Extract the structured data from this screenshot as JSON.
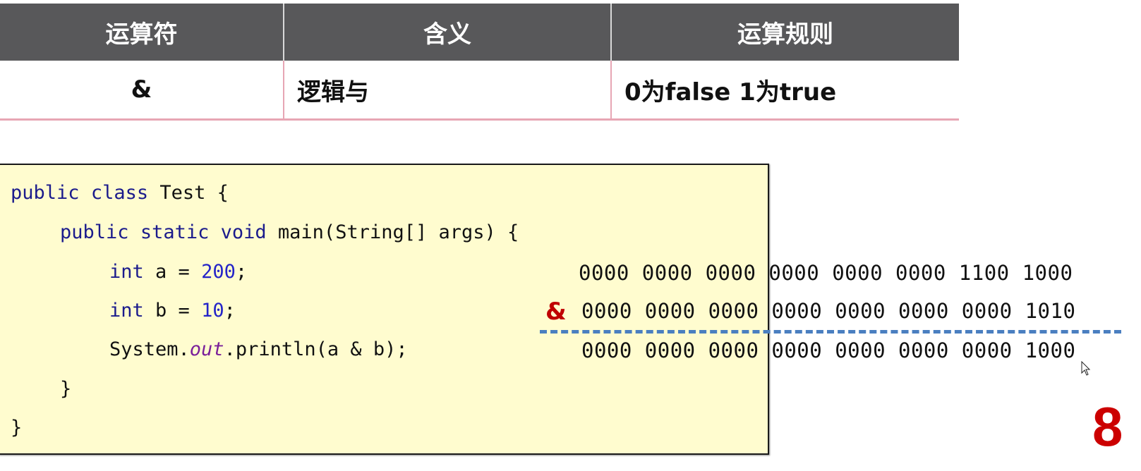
{
  "table": {
    "headers": [
      "运算符",
      "含义",
      "运算规则"
    ],
    "rows": [
      [
        "&",
        "逻辑与",
        "0为false 1为true"
      ]
    ]
  },
  "code": {
    "line1": {
      "kw1": "public",
      "kw2": "class",
      "rest": " Test {"
    },
    "line2": {
      "kw1": "public",
      "kw2": "static",
      "kw3": "void",
      "rest": " main(String[] args) {"
    },
    "line3": {
      "kw": "int",
      "mid": " a = ",
      "num": "200",
      "end": ";"
    },
    "line4": {
      "kw": "int",
      "mid": " b = ",
      "num": "10",
      "end": ";"
    },
    "line5": {
      "pre": "System.",
      "field": "out",
      "post": ".println(a & b);"
    },
    "line6": "}",
    "line7": "}"
  },
  "binary": {
    "a": "0000 0000 0000 0000 0000 0000 1100 1000",
    "operator": "&",
    "b": "0000 0000 0000 0000 0000 0000 0000 1010",
    "result": "0000 0000 0000 0000 0000 0000 0000 1000"
  },
  "result_decimal": "8",
  "colors": {
    "header_bg": "#58585a",
    "row_border": "#e7a6b4",
    "code_bg": "#fffccf",
    "operator_red": "#c00000",
    "result_red": "#cc0000",
    "dashed_line": "#4a7fc0"
  }
}
